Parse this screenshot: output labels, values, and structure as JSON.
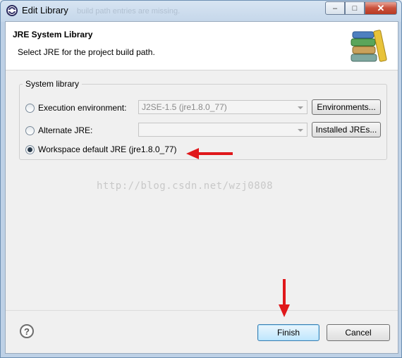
{
  "window": {
    "title": "Edit Library",
    "background_text": "build path entries are missing.",
    "controls": {
      "minimize": "–",
      "maximize": "□",
      "close": "✕"
    }
  },
  "header": {
    "title": "JRE System Library",
    "subtitle": "Select JRE for the project build path.",
    "icon": "books-icon"
  },
  "group": {
    "label": "System library",
    "options": [
      {
        "label": "Execution environment:",
        "selected": false,
        "combo_value": "J2SE-1.5 (jre1.8.0_77)",
        "button": "Environments..."
      },
      {
        "label": "Alternate JRE:",
        "selected": false,
        "combo_value": "",
        "button": "Installed JREs..."
      },
      {
        "label": "Workspace default JRE (jre1.8.0_77)",
        "selected": true
      }
    ]
  },
  "watermark": "http://blog.csdn.net/wzj0808",
  "footer": {
    "help": "?",
    "finish": "Finish",
    "cancel": "Cancel"
  },
  "colors": {
    "annotation_arrow": "#e0181b",
    "title_bar": "#c5d7ea",
    "default_button": "#bee6fd"
  }
}
